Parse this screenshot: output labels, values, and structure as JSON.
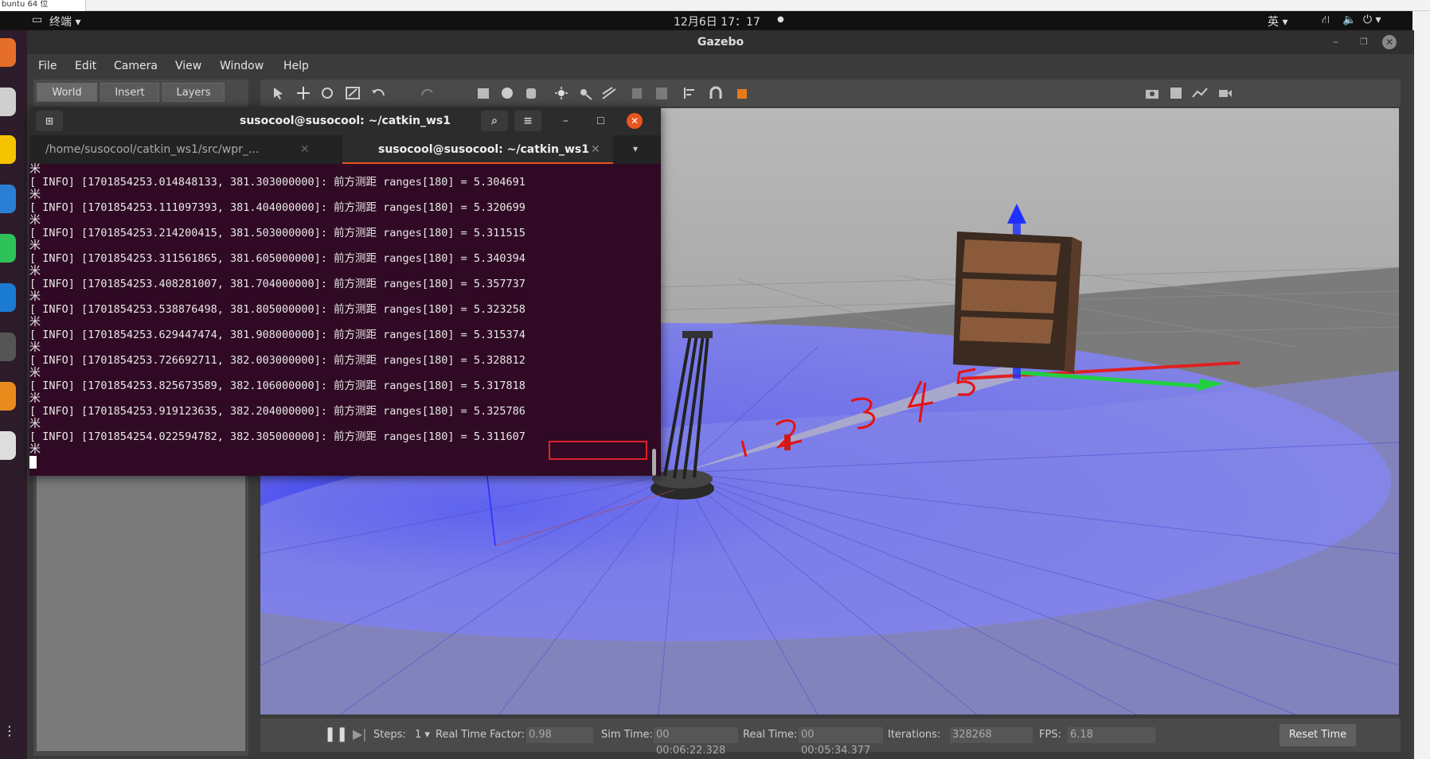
{
  "outer": {
    "tab_label": "buntu 64 位"
  },
  "topbar": {
    "activities_label": "终端",
    "datetime": "12月6日  17：17",
    "input_method": "英"
  },
  "gazebo": {
    "title": "Gazebo",
    "menus": [
      "File",
      "Edit",
      "Camera",
      "View",
      "Window",
      "Help"
    ],
    "left_tabs": [
      "World",
      "Insert",
      "Layers"
    ],
    "bottom": {
      "steps_label": "Steps:",
      "steps_value": "1",
      "rtf_label": "Real Time Factor:",
      "rtf_value": "0.98",
      "sim_time_label": "Sim Time:",
      "sim_time_value": "00 00:06:22.328",
      "real_time_label": "Real Time:",
      "real_time_value": "00 00:05:34.377",
      "iterations_label": "Iterations:",
      "iterations_value": "328268",
      "fps_label": "FPS:",
      "fps_value": "6.18",
      "reset_label": "Reset Time"
    },
    "annotations": [
      "1",
      "2",
      "3",
      "4",
      "5"
    ]
  },
  "terminal": {
    "title": "susocool@susocool: ~/catkin_ws1",
    "tab1": "/home/susocool/catkin_ws1/src/wpr_...",
    "tab2": "susocool@susocool: ~/catkin_ws1",
    "star": "米",
    "logs": [
      "[ INFO] [1701854253.014848133, 381.303000000]: 前方测距 ranges[180] = 5.304691",
      "[ INFO] [1701854253.111097393, 381.404000000]: 前方测距 ranges[180] = 5.320699",
      "[ INFO] [1701854253.214200415, 381.503000000]: 前方测距 ranges[180] = 5.311515",
      "[ INFO] [1701854253.311561865, 381.605000000]: 前方测距 ranges[180] = 5.340394",
      "[ INFO] [1701854253.408281007, 381.704000000]: 前方测距 ranges[180] = 5.357737",
      "[ INFO] [1701854253.538876498, 381.805000000]: 前方测距 ranges[180] = 5.323258",
      "[ INFO] [1701854253.629447474, 381.908000000]: 前方测距 ranges[180] = 5.315374",
      "[ INFO] [1701854253.726692711, 382.003000000]: 前方测距 ranges[180] = 5.328812",
      "[ INFO] [1701854253.825673589, 382.106000000]: 前方测距 ranges[180] = 5.317818",
      "[ INFO] [1701854253.919123635, 382.204000000]: 前方测距 ranges[180] = 5.325786",
      "[ INFO] [1701854254.022594782, 382.305000000]: 前方测距 ranges[180] = 5.311607"
    ],
    "highlight_color": "#e0202a"
  }
}
